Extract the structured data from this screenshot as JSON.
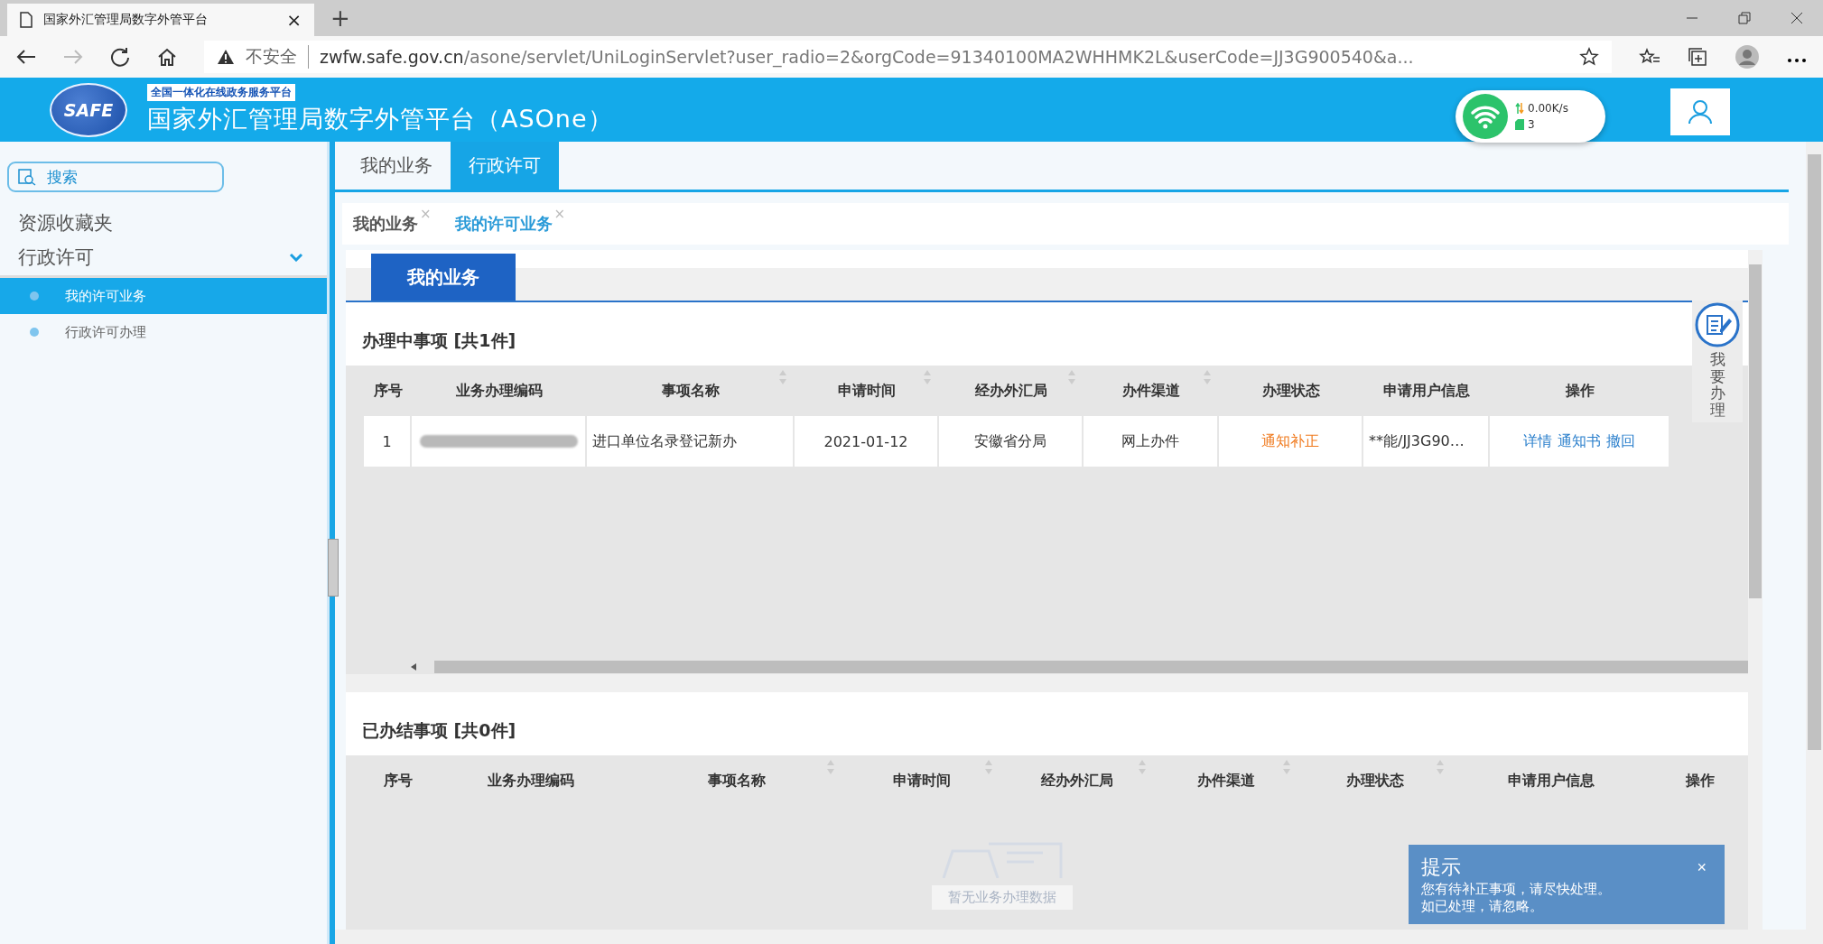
{
  "browser": {
    "tab_title": "国家外汇管理局数字外管平台",
    "tab_close": "×",
    "new_tab": "+",
    "security": "不安全",
    "url_host": "zwfw.safe.gov.cn",
    "url_path": "/asone/servlet/UniLoginServlet?user_radio=2&orgCode=91340100MA2WHHMK2L&userCode=JJ3G900540&a..."
  },
  "header": {
    "logo_text": "SAFE",
    "tagline": "全国一体化在线政务服务平台",
    "title": "国家外汇管理局数字外管平台（ASOne）"
  },
  "network_widget": {
    "speed": "0.00K/s",
    "count": "3"
  },
  "sidebar": {
    "search_placeholder": "搜索",
    "items": [
      {
        "label": "资源收藏夹",
        "kind": "link"
      },
      {
        "label": "行政许可",
        "kind": "group",
        "expanded": true,
        "children": [
          {
            "label": "我的许可业务",
            "selected": true
          },
          {
            "label": "行政许可办理",
            "selected": false
          }
        ]
      }
    ]
  },
  "top_tabs": [
    {
      "label": "我的业务",
      "selected": false
    },
    {
      "label": "行政许可",
      "selected": true
    }
  ],
  "open_tabs": [
    {
      "label": "我的业务",
      "selected": false,
      "close": "×"
    },
    {
      "label": "我的许可业务",
      "selected": true,
      "close": "×"
    }
  ],
  "section_tab": "我的业务",
  "in_progress": {
    "title": "办理中事项 [共1件]",
    "columns": [
      {
        "label": "序号",
        "sortable": false
      },
      {
        "label": "业务办理编码",
        "sortable": false
      },
      {
        "label": "事项名称",
        "sortable": true
      },
      {
        "label": "申请时间",
        "sortable": true
      },
      {
        "label": "经办外汇局",
        "sortable": true
      },
      {
        "label": "办件渠道",
        "sortable": true
      },
      {
        "label": "办理状态",
        "sortable": false
      },
      {
        "label": "申请用户信息",
        "sortable": false
      },
      {
        "label": "操作",
        "sortable": false
      }
    ],
    "rows": [
      {
        "index": "1",
        "name": "进口单位名录登记新办",
        "date": "2021-01-12",
        "bureau": "安徽省分局",
        "channel": "网上办件",
        "status": "通知补正",
        "user": "**能/JJ3G90…",
        "actions": [
          "详情",
          "通知书",
          "撤回"
        ]
      }
    ]
  },
  "float_button": "我要办理",
  "finished": {
    "title": "已办结事项 [共0件]",
    "columns": [
      {
        "label": "序号",
        "sortable": false
      },
      {
        "label": "业务办理编码",
        "sortable": false
      },
      {
        "label": "事项名称",
        "sortable": true
      },
      {
        "label": "申请时间",
        "sortable": true
      },
      {
        "label": "经办外汇局",
        "sortable": true
      },
      {
        "label": "办件渠道",
        "sortable": true
      },
      {
        "label": "办理状态",
        "sortable": true
      },
      {
        "label": "申请用户信息",
        "sortable": false
      },
      {
        "label": "操作",
        "sortable": false
      }
    ],
    "empty_text": "暂无业务办理数据"
  },
  "toast": {
    "title": "提示",
    "close": "×",
    "lines": [
      "您有待补正事项，请尽快处理。",
      "如已处理，请忽略。"
    ]
  }
}
